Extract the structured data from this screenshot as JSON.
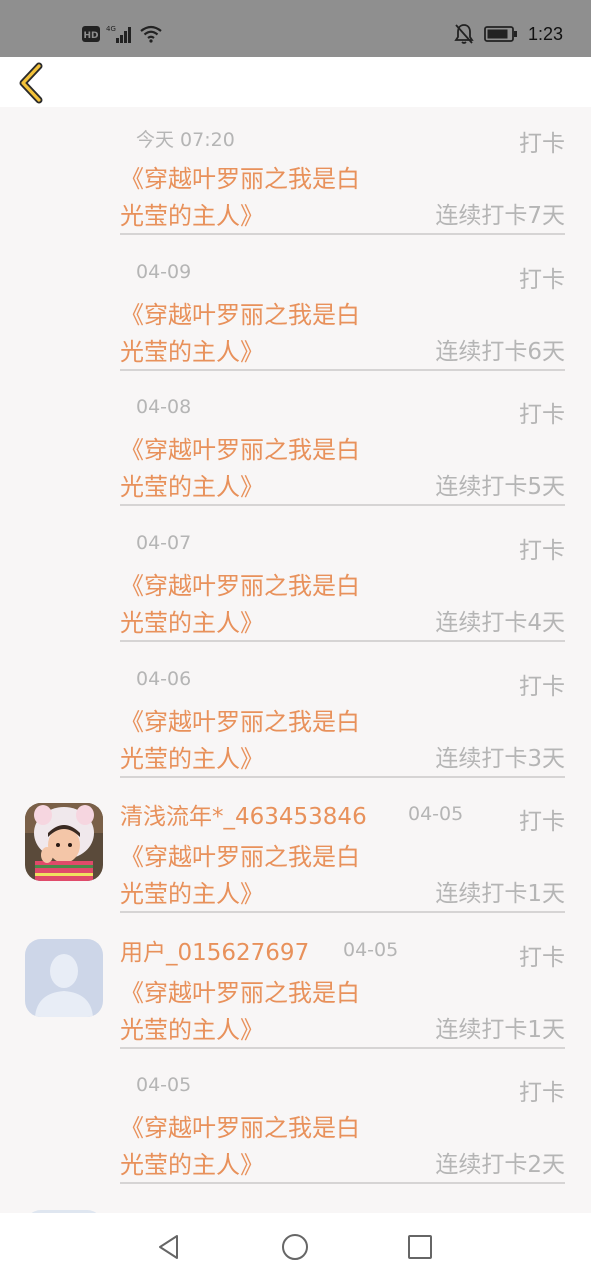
{
  "status_bar": {
    "hd": "HD",
    "network": "4G",
    "time": "1:23"
  },
  "header": {
    "back_icon": "chevron-left-icon",
    "accent": "#e8915b"
  },
  "colors": {
    "accent": "#e8915b",
    "muted": "#b5b5b5"
  },
  "entries": [
    {
      "date": "今天 07:20",
      "action": "打卡",
      "title_line1": "《穿越叶罗丽之我是白",
      "title_line2": "光莹的主人》",
      "streak": "连续打卡7天"
    },
    {
      "date": "04-09",
      "action": "打卡",
      "title_line1": "《穿越叶罗丽之我是白",
      "title_line2": "光莹的主人》",
      "streak": "连续打卡6天"
    },
    {
      "date": "04-08",
      "action": "打卡",
      "title_line1": "《穿越叶罗丽之我是白",
      "title_line2": "光莹的主人》",
      "streak": "连续打卡5天"
    },
    {
      "date": "04-07",
      "action": "打卡",
      "title_line1": "《穿越叶罗丽之我是白",
      "title_line2": "光莹的主人》",
      "streak": "连续打卡4天"
    },
    {
      "date": "04-06",
      "action": "打卡",
      "title_line1": "《穿越叶罗丽之我是白",
      "title_line2": "光莹的主人》",
      "streak": "连续打卡3天"
    },
    {
      "user": "清浅流年*_463453846",
      "date": "04-05",
      "action": "打卡",
      "title_line1": "《穿越叶罗丽之我是白",
      "title_line2": "光莹的主人》",
      "streak": "连续打卡1天"
    },
    {
      "user": "用户_015627697",
      "date": "04-05",
      "action": "打卡",
      "title_line1": "《穿越叶罗丽之我是白",
      "title_line2": "光莹的主人》",
      "streak": "连续打卡1天"
    },
    {
      "date": "04-05",
      "action": "打卡",
      "title_line1": "《穿越叶罗丽之我是白",
      "title_line2": "光莹的主人》",
      "streak": "连续打卡2天"
    }
  ],
  "nav": {
    "back": "triangle-back-icon",
    "home": "circle-home-icon",
    "recents": "square-recents-icon"
  }
}
